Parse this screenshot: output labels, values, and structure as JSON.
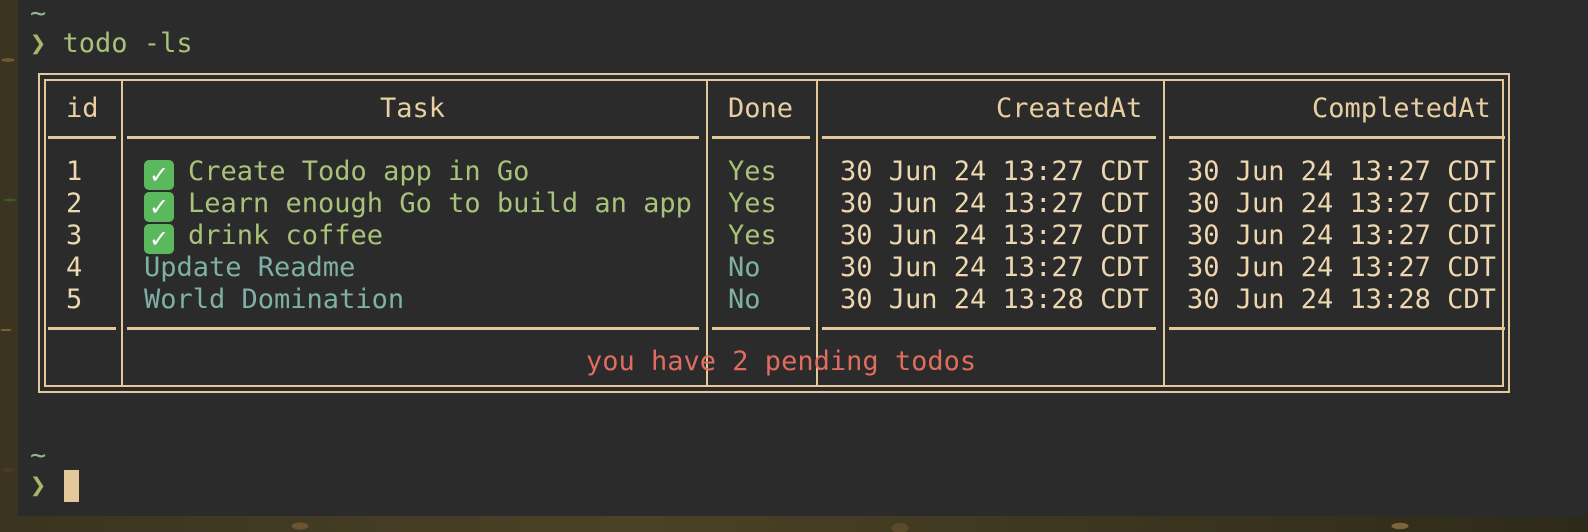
{
  "terminal": {
    "prompt_dir": "~",
    "prompt_symbol": "❯",
    "command": "todo -ls",
    "next_prompt_dir": "~",
    "next_prompt_symbol": "❯"
  },
  "table": {
    "headers": {
      "id": "id",
      "task": "Task",
      "done": "Done",
      "created": "CreatedAt",
      "completed": "CompletedAt"
    },
    "rows": [
      {
        "id": "1",
        "task": "Create Todo app in Go",
        "done": "Yes",
        "created": "30 Jun 24 13:27 CDT",
        "completed": "30 Jun 24 13:27 CDT"
      },
      {
        "id": "2",
        "task": "Learn enough Go to build an app",
        "done": "Yes",
        "created": "30 Jun 24 13:27 CDT",
        "completed": "30 Jun 24 13:27 CDT"
      },
      {
        "id": "3",
        "task": "drink coffee",
        "done": "Yes",
        "created": "30 Jun 24 13:27 CDT",
        "completed": "30 Jun 24 13:27 CDT"
      },
      {
        "id": "4",
        "task": "Update Readme",
        "done": "No",
        "created": "30 Jun 24 13:27 CDT",
        "completed": "30 Jun 24 13:27 CDT"
      },
      {
        "id": "5",
        "task": "World Domination",
        "done": "No",
        "created": "30 Jun 24 13:28 CDT",
        "completed": "30 Jun 24 13:28 CDT"
      }
    ],
    "footer": "you have 2 pending todos"
  },
  "icons": {
    "completed_marker": "check-mark-button-icon"
  },
  "colors": {
    "background": "#2b2b2b",
    "border": "#e3c99a",
    "done_task": "#a9c27a",
    "pending_task": "#7fb0a4",
    "footer": "#e06c5f",
    "check_icon": "#5cb85c"
  }
}
